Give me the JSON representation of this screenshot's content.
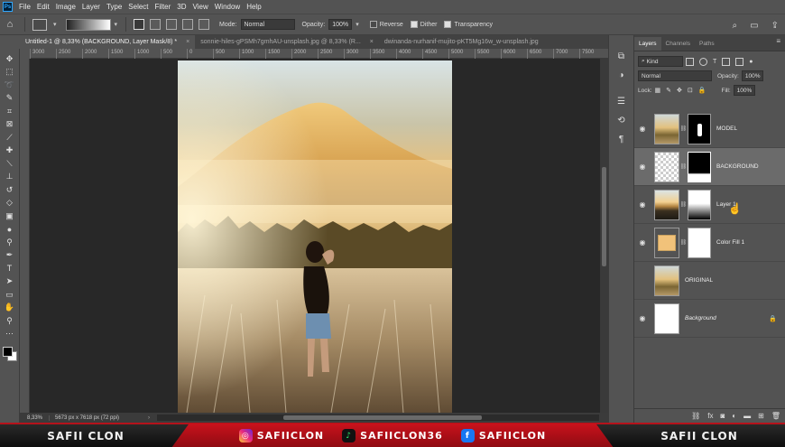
{
  "app": {
    "logo": "Ps"
  },
  "menu": [
    "File",
    "Edit",
    "Image",
    "Layer",
    "Type",
    "Select",
    "Filter",
    "3D",
    "View",
    "Window",
    "Help"
  ],
  "options": {
    "mode_label": "Mode:",
    "mode_value": "Normal",
    "opacity_label": "Opacity:",
    "opacity_value": "100%",
    "reverse": "Reverse",
    "dither": "Dither",
    "transparency": "Transparency"
  },
  "tabs": [
    {
      "label": "Untitled-1 @ 8,33% (BACKGROUND, Layer Mask/8) *",
      "active": true
    },
    {
      "label": "sonnie-hiles-gPSMh7gmhAU-unsplash.jpg @ 8,33% (R...",
      "active": false
    },
    {
      "label": "dwinanda-nurhanif-mujito-pKT5Mg16w_w-unsplash.jpg",
      "active": false
    }
  ],
  "ruler": [
    "3000",
    "2500",
    "2000",
    "1500",
    "1000",
    "500",
    "0",
    "500",
    "1000",
    "1500",
    "2000",
    "2500",
    "3000",
    "3500",
    "4000",
    "4500",
    "5000",
    "5500",
    "6000",
    "6500",
    "7000",
    "7500"
  ],
  "status": {
    "zoom": "8,33%",
    "info": "5673 px x 7618 px (72 ppi)"
  },
  "panel": {
    "tabs": [
      "Layers",
      "Channels",
      "Paths"
    ],
    "kind": "Kind",
    "blend": "Normal",
    "opacity_label": "Opacity:",
    "opacity_value": "100%",
    "lock_label": "Lock:",
    "fill_label": "Fill:",
    "fill_value": "100%"
  },
  "layers": [
    {
      "name": "MODEL",
      "visible": true,
      "selected": false
    },
    {
      "name": "BACKGROUND",
      "visible": true,
      "selected": true
    },
    {
      "name": "Layer 1",
      "visible": true,
      "selected": false
    },
    {
      "name": "Color Fill 1",
      "visible": true,
      "selected": false
    },
    {
      "name": "ORIGINAL",
      "visible": false,
      "selected": false
    },
    {
      "name": "Background",
      "visible": true,
      "selected": false,
      "locked": true
    }
  ],
  "banner": {
    "left": "SAFII CLON",
    "right": "SAFII CLON",
    "instagram": "SAFIICLON",
    "tiktok": "SAFIICLON36",
    "facebook": "SAFIICLON"
  },
  "colors": {
    "accent": "#31a8ff",
    "banner_red": "#c9121c",
    "fill_swatch": "#f1c27a"
  }
}
